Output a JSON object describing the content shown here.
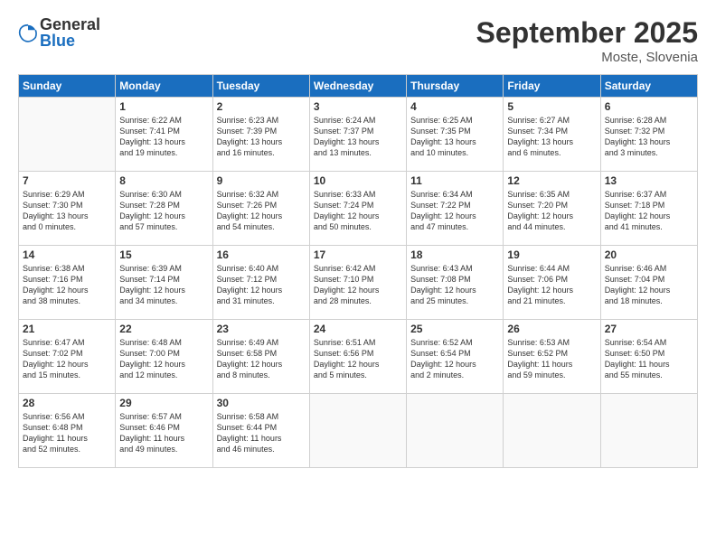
{
  "logo": {
    "general": "General",
    "blue": "Blue"
  },
  "title": "September 2025",
  "location": "Moste, Slovenia",
  "days_header": [
    "Sunday",
    "Monday",
    "Tuesday",
    "Wednesday",
    "Thursday",
    "Friday",
    "Saturday"
  ],
  "weeks": [
    [
      {
        "num": "",
        "info": ""
      },
      {
        "num": "1",
        "info": "Sunrise: 6:22 AM\nSunset: 7:41 PM\nDaylight: 13 hours\nand 19 minutes."
      },
      {
        "num": "2",
        "info": "Sunrise: 6:23 AM\nSunset: 7:39 PM\nDaylight: 13 hours\nand 16 minutes."
      },
      {
        "num": "3",
        "info": "Sunrise: 6:24 AM\nSunset: 7:37 PM\nDaylight: 13 hours\nand 13 minutes."
      },
      {
        "num": "4",
        "info": "Sunrise: 6:25 AM\nSunset: 7:35 PM\nDaylight: 13 hours\nand 10 minutes."
      },
      {
        "num": "5",
        "info": "Sunrise: 6:27 AM\nSunset: 7:34 PM\nDaylight: 13 hours\nand 6 minutes."
      },
      {
        "num": "6",
        "info": "Sunrise: 6:28 AM\nSunset: 7:32 PM\nDaylight: 13 hours\nand 3 minutes."
      }
    ],
    [
      {
        "num": "7",
        "info": "Sunrise: 6:29 AM\nSunset: 7:30 PM\nDaylight: 13 hours\nand 0 minutes."
      },
      {
        "num": "8",
        "info": "Sunrise: 6:30 AM\nSunset: 7:28 PM\nDaylight: 12 hours\nand 57 minutes."
      },
      {
        "num": "9",
        "info": "Sunrise: 6:32 AM\nSunset: 7:26 PM\nDaylight: 12 hours\nand 54 minutes."
      },
      {
        "num": "10",
        "info": "Sunrise: 6:33 AM\nSunset: 7:24 PM\nDaylight: 12 hours\nand 50 minutes."
      },
      {
        "num": "11",
        "info": "Sunrise: 6:34 AM\nSunset: 7:22 PM\nDaylight: 12 hours\nand 47 minutes."
      },
      {
        "num": "12",
        "info": "Sunrise: 6:35 AM\nSunset: 7:20 PM\nDaylight: 12 hours\nand 44 minutes."
      },
      {
        "num": "13",
        "info": "Sunrise: 6:37 AM\nSunset: 7:18 PM\nDaylight: 12 hours\nand 41 minutes."
      }
    ],
    [
      {
        "num": "14",
        "info": "Sunrise: 6:38 AM\nSunset: 7:16 PM\nDaylight: 12 hours\nand 38 minutes."
      },
      {
        "num": "15",
        "info": "Sunrise: 6:39 AM\nSunset: 7:14 PM\nDaylight: 12 hours\nand 34 minutes."
      },
      {
        "num": "16",
        "info": "Sunrise: 6:40 AM\nSunset: 7:12 PM\nDaylight: 12 hours\nand 31 minutes."
      },
      {
        "num": "17",
        "info": "Sunrise: 6:42 AM\nSunset: 7:10 PM\nDaylight: 12 hours\nand 28 minutes."
      },
      {
        "num": "18",
        "info": "Sunrise: 6:43 AM\nSunset: 7:08 PM\nDaylight: 12 hours\nand 25 minutes."
      },
      {
        "num": "19",
        "info": "Sunrise: 6:44 AM\nSunset: 7:06 PM\nDaylight: 12 hours\nand 21 minutes."
      },
      {
        "num": "20",
        "info": "Sunrise: 6:46 AM\nSunset: 7:04 PM\nDaylight: 12 hours\nand 18 minutes."
      }
    ],
    [
      {
        "num": "21",
        "info": "Sunrise: 6:47 AM\nSunset: 7:02 PM\nDaylight: 12 hours\nand 15 minutes."
      },
      {
        "num": "22",
        "info": "Sunrise: 6:48 AM\nSunset: 7:00 PM\nDaylight: 12 hours\nand 12 minutes."
      },
      {
        "num": "23",
        "info": "Sunrise: 6:49 AM\nSunset: 6:58 PM\nDaylight: 12 hours\nand 8 minutes."
      },
      {
        "num": "24",
        "info": "Sunrise: 6:51 AM\nSunset: 6:56 PM\nDaylight: 12 hours\nand 5 minutes."
      },
      {
        "num": "25",
        "info": "Sunrise: 6:52 AM\nSunset: 6:54 PM\nDaylight: 12 hours\nand 2 minutes."
      },
      {
        "num": "26",
        "info": "Sunrise: 6:53 AM\nSunset: 6:52 PM\nDaylight: 11 hours\nand 59 minutes."
      },
      {
        "num": "27",
        "info": "Sunrise: 6:54 AM\nSunset: 6:50 PM\nDaylight: 11 hours\nand 55 minutes."
      }
    ],
    [
      {
        "num": "28",
        "info": "Sunrise: 6:56 AM\nSunset: 6:48 PM\nDaylight: 11 hours\nand 52 minutes."
      },
      {
        "num": "29",
        "info": "Sunrise: 6:57 AM\nSunset: 6:46 PM\nDaylight: 11 hours\nand 49 minutes."
      },
      {
        "num": "30",
        "info": "Sunrise: 6:58 AM\nSunset: 6:44 PM\nDaylight: 11 hours\nand 46 minutes."
      },
      {
        "num": "",
        "info": ""
      },
      {
        "num": "",
        "info": ""
      },
      {
        "num": "",
        "info": ""
      },
      {
        "num": "",
        "info": ""
      }
    ]
  ]
}
